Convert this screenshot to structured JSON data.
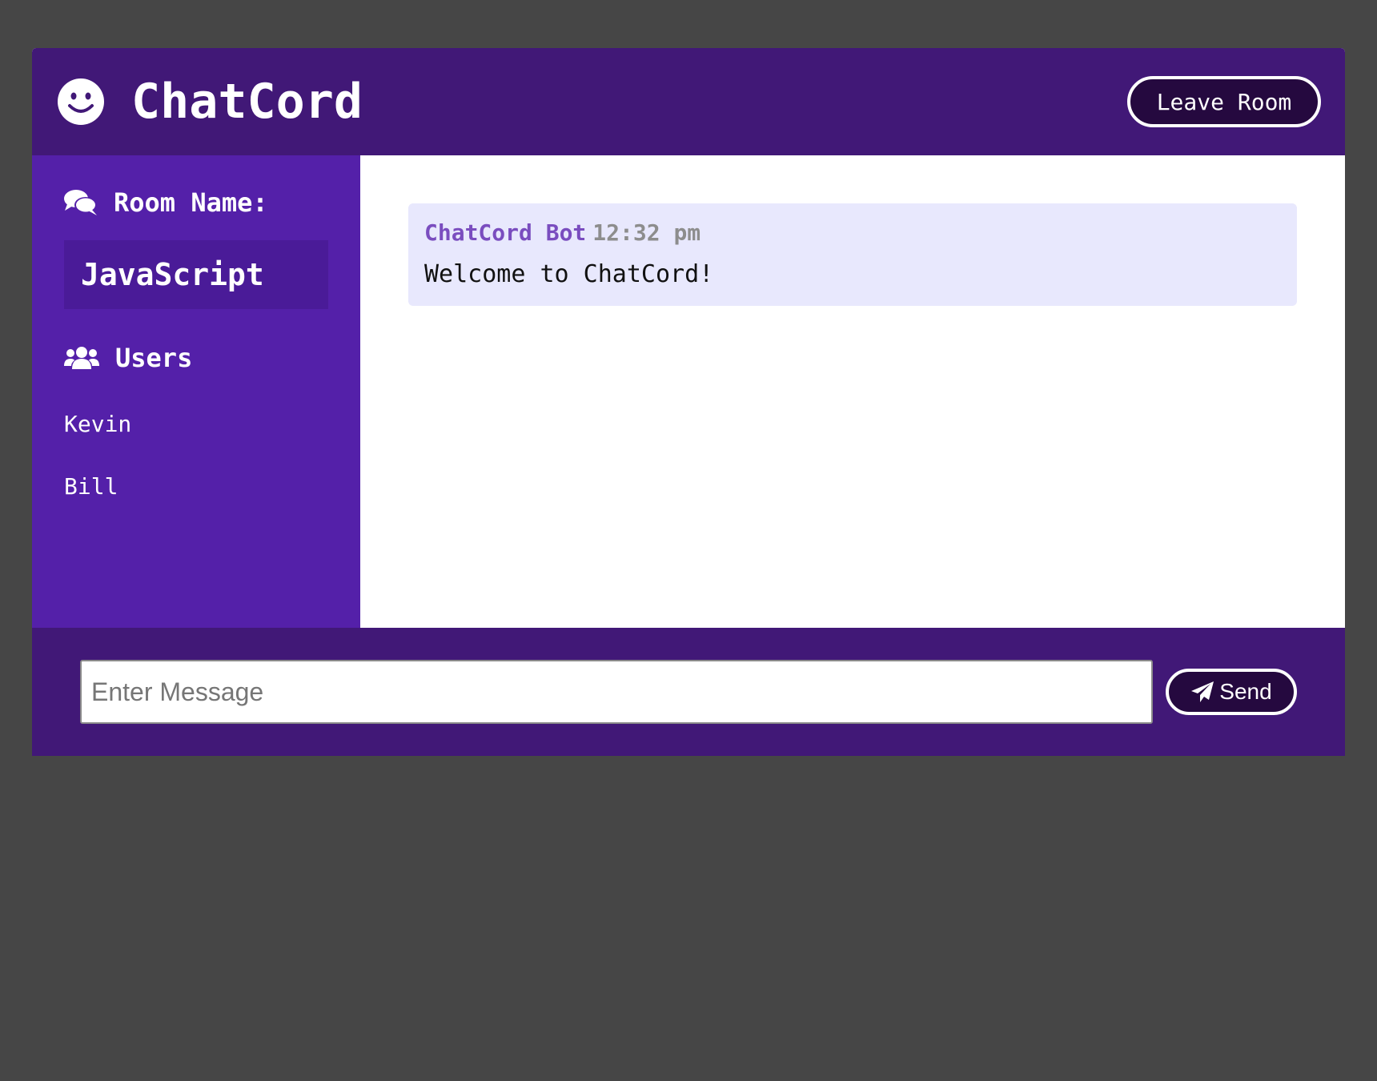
{
  "app": {
    "title": "ChatCord",
    "logo_icon": "smile-icon"
  },
  "header": {
    "leave_button_label": "Leave Room"
  },
  "sidebar": {
    "room_heading_icon": "comments-icon",
    "room_heading": "Room Name:",
    "room_name": "JavaScript",
    "users_heading_icon": "users-icon",
    "users_heading": "Users",
    "users": [
      "Kevin",
      "Bill"
    ]
  },
  "messages": [
    {
      "author": "ChatCord Bot",
      "time": "12:32 pm",
      "text": "Welcome to ChatCord!"
    }
  ],
  "composer": {
    "placeholder": "Enter Message",
    "value": "",
    "send_icon": "paper-plane-icon",
    "send_label": "Send"
  },
  "colors": {
    "page_background": "#464646",
    "header_background": "#411877",
    "sidebar_background": "#5420a9",
    "room_box_background": "#4a1b98",
    "button_background": "#25093f",
    "message_background": "#e8e8fd",
    "author_color": "#7a4dbf",
    "time_color": "#8d8d8d"
  }
}
